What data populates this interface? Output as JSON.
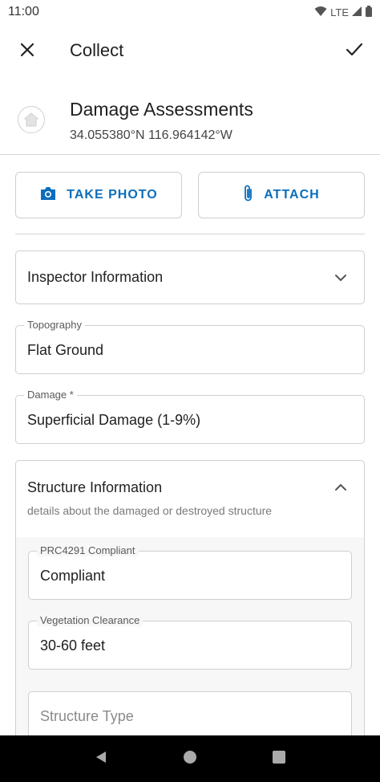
{
  "status": {
    "time": "11:00",
    "network": "LTE"
  },
  "toolbar": {
    "title": "Collect"
  },
  "layer": {
    "title": "Damage Assessments",
    "coords": "34.055380°N  116.964142°W"
  },
  "actions": {
    "take_photo": "TAKE PHOTO",
    "attach": "ATTACH"
  },
  "sections": {
    "inspector": {
      "title": "Inspector Information"
    },
    "structure": {
      "title": "Structure Information",
      "description": "details about the damaged or destroyed structure"
    }
  },
  "fields": {
    "topography": {
      "label": "Topography",
      "value": "Flat Ground"
    },
    "damage": {
      "label": "Damage *",
      "value": "Superficial Damage (1-9%)"
    },
    "prc4291": {
      "label": "PRC4291 Compliant",
      "value": "Compliant"
    },
    "vegetation": {
      "label": "Vegetation Clearance",
      "value": "30-60 feet"
    },
    "structure_type": {
      "placeholder": "Structure Type"
    }
  },
  "colors": {
    "accent": "#0a6ebd",
    "border": "#cfcfcf",
    "nav_bar": "#000000"
  }
}
